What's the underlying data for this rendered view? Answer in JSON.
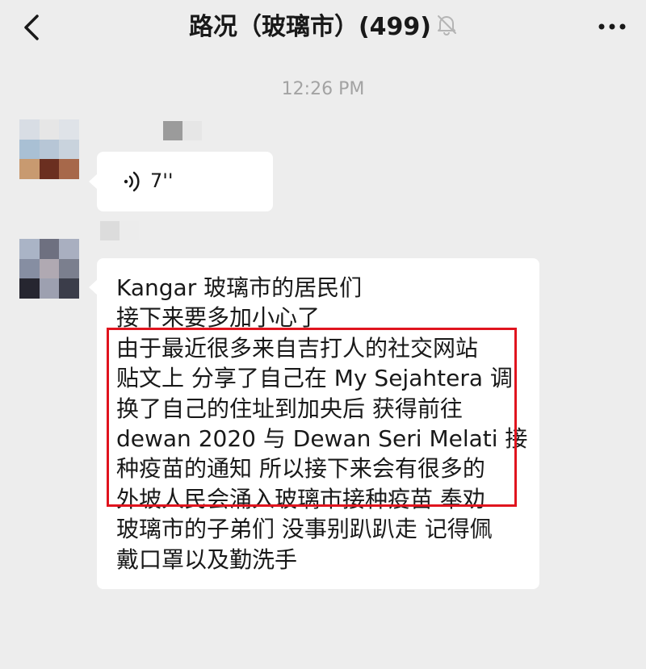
{
  "header": {
    "title": "路况（玻璃市）(499)",
    "back_icon": "chevron-left-icon",
    "mute_icon": "bell-off-icon",
    "more_icon": "more-dots-icon"
  },
  "timestamp": "12:26 PM",
  "messages": [
    {
      "type": "voice",
      "duration": "7''",
      "icon": "voice-wave-icon"
    },
    {
      "type": "text",
      "lines": [
        "Kangar 玻璃市的居民们",
        "接下来要多加小心了",
        "由于最近很多来自吉打人的社交网站",
        "贴文上 分享了自己在 My Sejahtera 调",
        "换了自己的住址到加央后 获得前往",
        "dewan 2020 与 Dewan Seri Melati 接",
        "种疫苗的通知 所以接下来会有很多的",
        "外坡人民会涌入玻璃市接种疫苗 奉劝",
        "玻璃市的子弟们 没事别趴趴走 记得佩",
        "戴口罩以及勤洗手"
      ]
    }
  ],
  "colors": {
    "background": "#ededed",
    "bubble": "#ffffff",
    "highlight_border": "#e0141e",
    "timestamp": "#a3a3a3"
  }
}
